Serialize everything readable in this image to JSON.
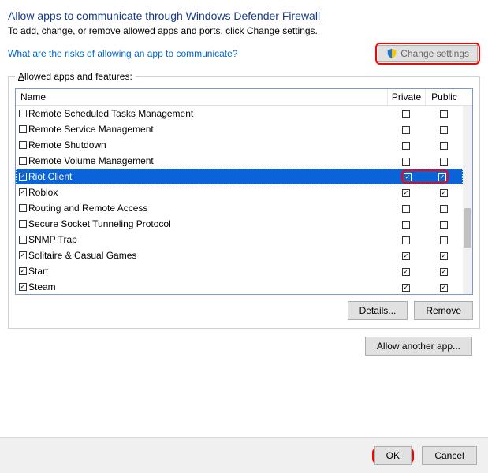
{
  "title": "Allow apps to communicate through Windows Defender Firewall",
  "subtitle": "To add, change, or remove allowed apps and ports, click Change settings.",
  "risks_link": "What are the risks of allowing an app to communicate?",
  "change_settings": "Change settings",
  "group_legend_prefix": "A",
  "group_legend_rest": "llowed apps and features:",
  "columns": {
    "name": "Name",
    "private": "Private",
    "public": "Public"
  },
  "apps": [
    {
      "name": "Remote Scheduled Tasks Management",
      "enabled": false,
      "private": false,
      "public": false
    },
    {
      "name": "Remote Service Management",
      "enabled": false,
      "private": false,
      "public": false
    },
    {
      "name": "Remote Shutdown",
      "enabled": false,
      "private": false,
      "public": false
    },
    {
      "name": "Remote Volume Management",
      "enabled": false,
      "private": false,
      "public": false
    },
    {
      "name": "Riot Client",
      "enabled": true,
      "private": true,
      "public": true,
      "selected": true
    },
    {
      "name": "Roblox",
      "enabled": true,
      "private": true,
      "public": true
    },
    {
      "name": "Routing and Remote Access",
      "enabled": false,
      "private": false,
      "public": false
    },
    {
      "name": "Secure Socket Tunneling Protocol",
      "enabled": false,
      "private": false,
      "public": false
    },
    {
      "name": "SNMP Trap",
      "enabled": false,
      "private": false,
      "public": false
    },
    {
      "name": "Solitaire & Casual Games",
      "enabled": true,
      "private": true,
      "public": true
    },
    {
      "name": "Start",
      "enabled": true,
      "private": true,
      "public": true
    },
    {
      "name": "Steam",
      "enabled": true,
      "private": true,
      "public": true
    }
  ],
  "buttons": {
    "details": "Details...",
    "remove": "Remove",
    "allow_another": "Allow another app...",
    "ok": "OK",
    "cancel": "Cancel"
  }
}
